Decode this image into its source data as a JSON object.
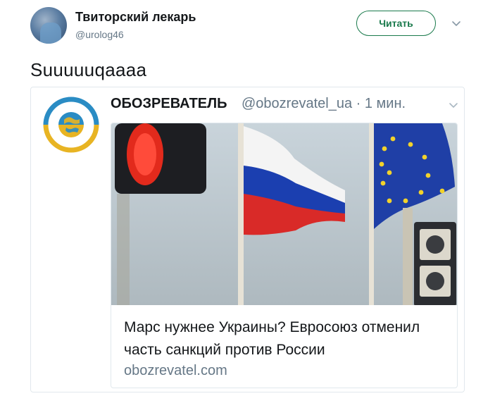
{
  "tweet": {
    "author": {
      "display_name": "Твиторский лекарь",
      "handle": "@urolog46"
    },
    "follow_label": "Читать",
    "text": "Suuuuuqaaaa"
  },
  "quoted": {
    "source_name": "ОБОЗРЕВАТЕЛЬ",
    "source_meta": "@obozrevatel_ua · 1 мин.",
    "link_title": "Марс нужнее Украины? Евросоюз отменил часть санкций против России",
    "link_domain": "obozrevatel.com"
  },
  "colors": {
    "follow_green": "#1a7a4c",
    "muted": "#657786",
    "border": "#e1e8ed"
  },
  "icons": [
    "avatar",
    "chevron-down-icon",
    "obozrevatel-logo",
    "flags-photo"
  ]
}
